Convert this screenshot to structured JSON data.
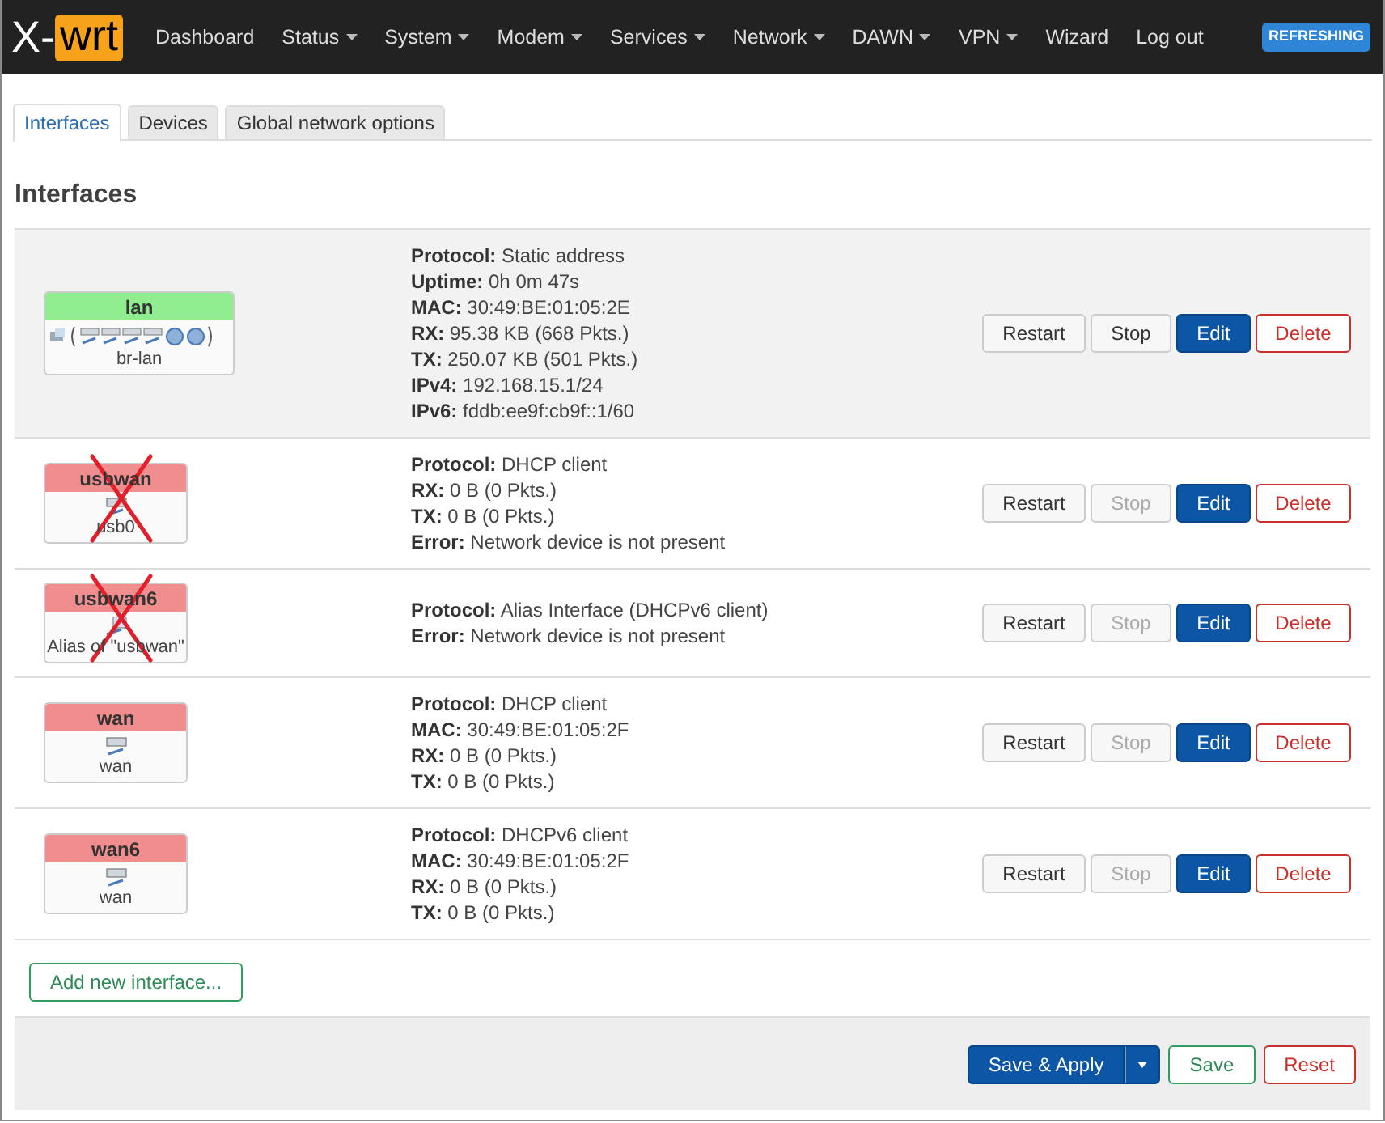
{
  "brand": {
    "prefix": "X-",
    "highlight": "wrt"
  },
  "nav": [
    {
      "label": "Dashboard",
      "dropdown": false
    },
    {
      "label": "Status",
      "dropdown": true
    },
    {
      "label": "System",
      "dropdown": true
    },
    {
      "label": "Modem",
      "dropdown": true
    },
    {
      "label": "Services",
      "dropdown": true
    },
    {
      "label": "Network",
      "dropdown": true
    },
    {
      "label": "DAWN",
      "dropdown": true
    },
    {
      "label": "VPN",
      "dropdown": true
    },
    {
      "label": "Wizard",
      "dropdown": false
    },
    {
      "label": "Log out",
      "dropdown": false
    }
  ],
  "status_badge": "REFRESHING",
  "tabs": [
    {
      "label": "Interfaces",
      "selected": true
    },
    {
      "label": "Devices",
      "selected": false
    },
    {
      "label": "Global network options",
      "selected": false
    }
  ],
  "heading": "Interfaces",
  "interfaces": [
    {
      "name": "lan",
      "up": true,
      "kind": "bridge",
      "device": "br-lan",
      "crossed": false,
      "highlighted": true,
      "details": [
        {
          "label": "Protocol:",
          "value": "Static address"
        },
        {
          "label": "Uptime:",
          "value": "0h 0m 47s"
        },
        {
          "label": "MAC:",
          "value": "30:49:BE:01:05:2E"
        },
        {
          "label": "RX:",
          "value": "95.38 KB (668 Pkts.)"
        },
        {
          "label": "TX:",
          "value": "250.07 KB (501 Pkts.)"
        },
        {
          "label": "IPv4:",
          "value": "192.168.15.1/24"
        },
        {
          "label": "IPv6:",
          "value": "fddb:ee9f:cb9f::1/60"
        }
      ],
      "buttons": [
        {
          "kind": "restart",
          "label": "Restart",
          "disabled": false
        },
        {
          "kind": "stop",
          "label": "Stop",
          "disabled": false
        },
        {
          "kind": "edit",
          "label": "Edit",
          "disabled": false
        },
        {
          "kind": "delete",
          "label": "Delete",
          "disabled": false
        }
      ]
    },
    {
      "name": "usbwan",
      "up": false,
      "kind": "ethernet",
      "device": "usb0",
      "crossed": true,
      "highlighted": false,
      "details": [
        {
          "label": "Protocol:",
          "value": "DHCP client"
        },
        {
          "label": "RX:",
          "value": "0 B (0 Pkts.)"
        },
        {
          "label": "TX:",
          "value": "0 B (0 Pkts.)"
        },
        {
          "label": "Error:",
          "value": "Network device is not present"
        }
      ],
      "buttons": [
        {
          "kind": "restart",
          "label": "Restart",
          "disabled": false
        },
        {
          "kind": "stop",
          "label": "Stop",
          "disabled": true
        },
        {
          "kind": "edit",
          "label": "Edit",
          "disabled": false
        },
        {
          "kind": "delete",
          "label": "Delete",
          "disabled": false
        }
      ]
    },
    {
      "name": "usbwan6",
      "up": false,
      "kind": "alias",
      "device": "Alias of \"usbwan\"",
      "crossed": true,
      "highlighted": false,
      "details": [
        {
          "label": "Protocol:",
          "value": "Alias Interface (DHCPv6 client)"
        },
        {
          "label": "Error:",
          "value": "Network device is not present"
        }
      ],
      "buttons": [
        {
          "kind": "restart",
          "label": "Restart",
          "disabled": false
        },
        {
          "kind": "stop",
          "label": "Stop",
          "disabled": true
        },
        {
          "kind": "edit",
          "label": "Edit",
          "disabled": false
        },
        {
          "kind": "delete",
          "label": "Delete",
          "disabled": false
        }
      ]
    },
    {
      "name": "wan",
      "up": false,
      "kind": "ethernet",
      "device": "wan",
      "crossed": false,
      "highlighted": false,
      "details": [
        {
          "label": "Protocol:",
          "value": "DHCP client"
        },
        {
          "label": "MAC:",
          "value": "30:49:BE:01:05:2F"
        },
        {
          "label": "RX:",
          "value": "0 B (0 Pkts.)"
        },
        {
          "label": "TX:",
          "value": "0 B (0 Pkts.)"
        }
      ],
      "buttons": [
        {
          "kind": "restart",
          "label": "Restart",
          "disabled": false
        },
        {
          "kind": "stop",
          "label": "Stop",
          "disabled": true
        },
        {
          "kind": "edit",
          "label": "Edit",
          "disabled": false
        },
        {
          "kind": "delete",
          "label": "Delete",
          "disabled": false
        }
      ]
    },
    {
      "name": "wan6",
      "up": false,
      "kind": "ethernet",
      "device": "wan",
      "crossed": false,
      "highlighted": false,
      "details": [
        {
          "label": "Protocol:",
          "value": "DHCPv6 client"
        },
        {
          "label": "MAC:",
          "value": "30:49:BE:01:05:2F"
        },
        {
          "label": "RX:",
          "value": "0 B (0 Pkts.)"
        },
        {
          "label": "TX:",
          "value": "0 B (0 Pkts.)"
        }
      ],
      "buttons": [
        {
          "kind": "restart",
          "label": "Restart",
          "disabled": false
        },
        {
          "kind": "stop",
          "label": "Stop",
          "disabled": true
        },
        {
          "kind": "edit",
          "label": "Edit",
          "disabled": false
        },
        {
          "kind": "delete",
          "label": "Delete",
          "disabled": false
        }
      ]
    }
  ],
  "add_button": "Add new interface...",
  "footer_buttons": {
    "save_apply": "Save & Apply",
    "save": "Save",
    "reset": "Reset"
  }
}
